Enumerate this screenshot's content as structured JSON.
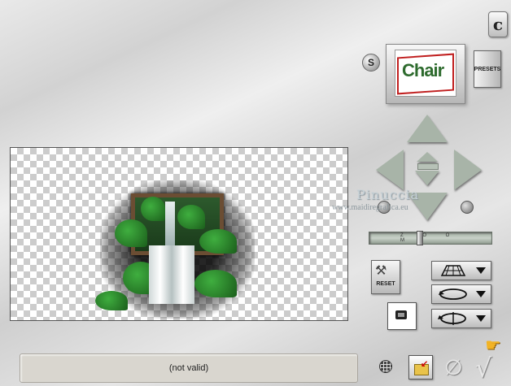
{
  "header": {
    "logo_glyph": "c",
    "s_button_label": "S",
    "presets_label": "PRESETS"
  },
  "preview": {
    "thumbnail_text": "Chair"
  },
  "watermark": {
    "name": "Pinuccia",
    "url": "www.maidiregrafica.eu"
  },
  "zoom": {
    "labels": "Z O O M"
  },
  "tools": {
    "reset_label": "RESET"
  },
  "status": {
    "text": "(not valid)"
  },
  "icons": {
    "cancel_glyph": "∅",
    "ok_glyph": "√",
    "help_glyph": "☛"
  }
}
